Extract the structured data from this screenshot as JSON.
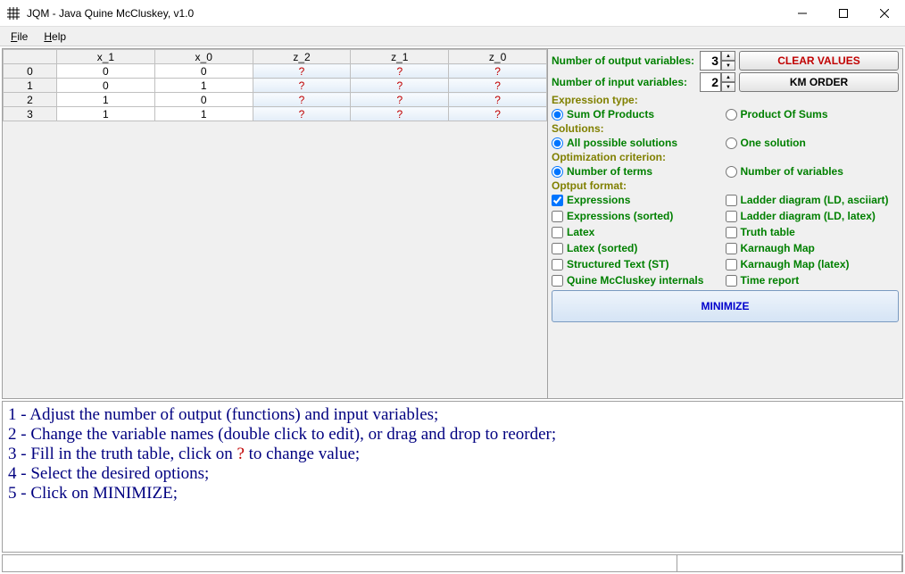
{
  "window": {
    "title": "JQM - Java Quine McCluskey, v1.0"
  },
  "menu": {
    "file": "File",
    "help": "Help"
  },
  "table": {
    "headers": [
      "x_1",
      "x_0",
      "z_2",
      "z_1",
      "z_0"
    ],
    "rows": [
      {
        "idx": "0",
        "x": [
          "0",
          "0"
        ],
        "z": [
          "?",
          "?",
          "?"
        ]
      },
      {
        "idx": "1",
        "x": [
          "0",
          "1"
        ],
        "z": [
          "?",
          "?",
          "?"
        ]
      },
      {
        "idx": "2",
        "x": [
          "1",
          "0"
        ],
        "z": [
          "?",
          "?",
          "?"
        ]
      },
      {
        "idx": "3",
        "x": [
          "1",
          "1"
        ],
        "z": [
          "?",
          "?",
          "?"
        ]
      }
    ]
  },
  "controls": {
    "outvar_label": "Number of output variables:",
    "outvar_value": "3",
    "invar_label": "Number  of  input  variables:",
    "invar_value": "2",
    "clear_btn": "CLEAR VALUES",
    "km_btn": "KM ORDER",
    "exprtype_label": "Expression type:",
    "exprtype_opts": [
      "Sum Of Products",
      "Product Of Sums"
    ],
    "solutions_label": "Solutions:",
    "solutions_opts": [
      "All possible solutions",
      "One solution"
    ],
    "optcrit_label": "Optimization criterion:",
    "optcrit_opts": [
      "Number of terms",
      "Number of variables"
    ],
    "outfmt_label": "Optput format:",
    "outfmt_opts": [
      [
        "Expressions",
        "Ladder diagram (LD, asciiart)"
      ],
      [
        "Expressions (sorted)",
        "Ladder diagram (LD, latex)"
      ],
      [
        "Latex",
        "Truth table"
      ],
      [
        "Latex (sorted)",
        "Karnaugh Map"
      ],
      [
        "Structured Text (ST)",
        "Karnaugh Map (latex)"
      ],
      [
        "Quine McCluskey internals",
        "Time report"
      ]
    ],
    "outfmt_checked": [
      true,
      false,
      false,
      false,
      false,
      false,
      false,
      false,
      false,
      false,
      false,
      false
    ],
    "minimize_btn": "MINIMIZE"
  },
  "instructions": {
    "l1a": "1 - Adjust the number of output (functions) and input variables;",
    "l2a": "2 - Change the variable names (double click to edit), or drag and drop to reorder;",
    "l3a": "3 - Fill in the truth table, click on ",
    "l3q": "?",
    "l3b": " to change value;",
    "l4a": "4 - Select the desired options;",
    "l5a": "5 - Click on MINIMIZE;"
  }
}
